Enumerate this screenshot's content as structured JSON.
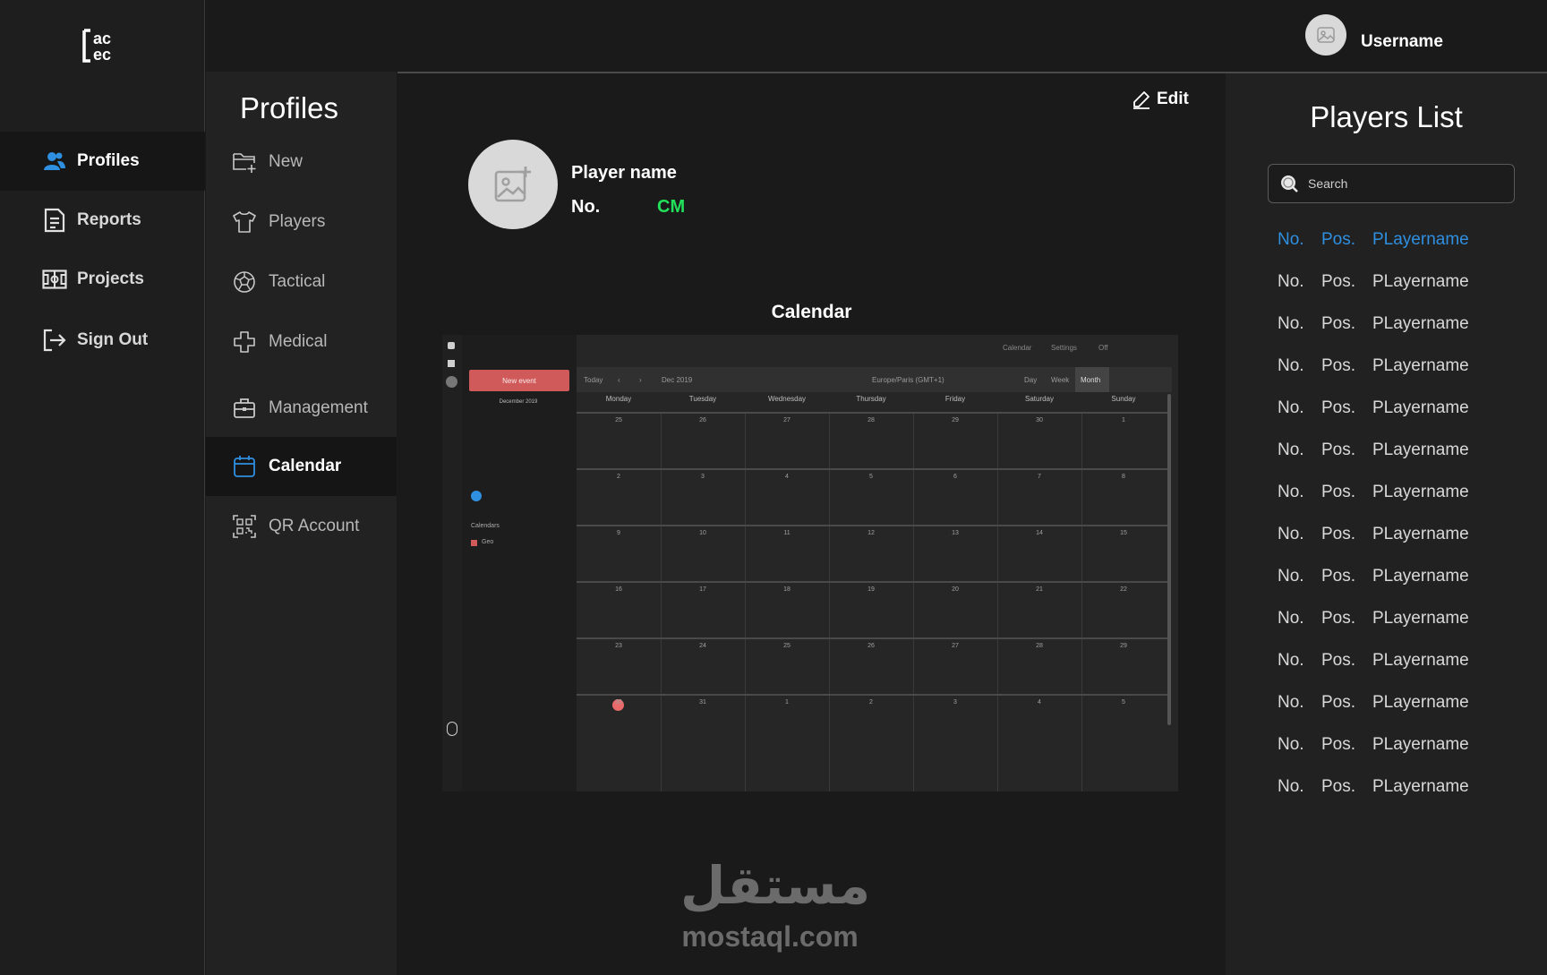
{
  "user": {
    "name": "Username"
  },
  "nav": [
    {
      "label": "Profiles",
      "icon": "user-group-icon",
      "active": true
    },
    {
      "label": "Reports",
      "icon": "document-icon",
      "active": false
    },
    {
      "label": "Projects",
      "icon": "pitch-icon",
      "active": false
    },
    {
      "label": "Sign Out",
      "icon": "sign-out-icon",
      "active": false
    }
  ],
  "submenu": {
    "title": "Profiles",
    "items": [
      {
        "label": "New",
        "icon": "new-folder-icon"
      },
      {
        "label": "Players",
        "icon": "shirt-icon"
      },
      {
        "label": "Tactical",
        "icon": "football-icon"
      },
      {
        "label": "Medical",
        "icon": "medical-cross-icon"
      },
      {
        "label": "Management",
        "icon": "briefcase-icon"
      },
      {
        "label": "Calendar",
        "icon": "calendar-icon",
        "active": true
      },
      {
        "label": "QR Account",
        "icon": "qr-code-icon"
      }
    ]
  },
  "profile": {
    "edit_label": "Edit",
    "name_label": "Player name",
    "no_label": "No.",
    "position": "CM",
    "position_color": "#22e05a"
  },
  "calendar": {
    "title": "Calendar",
    "new_event": "New event",
    "today": "Today",
    "month_label": "Dec 2019",
    "timezone": "Europe/Paris (GMT+1)",
    "views": [
      "Day",
      "Week",
      "Month"
    ],
    "top_links": [
      "Calendar",
      "Settings",
      "Off"
    ],
    "mini_title": "December 2019",
    "calendars_label": "Calendars",
    "calendar_name": "Geo",
    "days": [
      "Monday",
      "Tuesday",
      "Wednesday",
      "Thursday",
      "Friday",
      "Saturday",
      "Sunday"
    ],
    "weeks": [
      [
        "25",
        "26",
        "27",
        "28",
        "29",
        "30",
        "1"
      ],
      [
        "2",
        "3",
        "4",
        "5",
        "6",
        "7",
        "8"
      ],
      [
        "9",
        "10",
        "11",
        "12",
        "13",
        "14",
        "15"
      ],
      [
        "16",
        "17",
        "18",
        "19",
        "20",
        "21",
        "22"
      ],
      [
        "23",
        "24",
        "25",
        "26",
        "27",
        "28",
        "29"
      ],
      [
        "30",
        "31",
        "1",
        "2",
        "3",
        "4",
        "5"
      ]
    ],
    "accent": "#d05a5a"
  },
  "players": {
    "title": "Players List",
    "search_placeholder": "Search",
    "highlight_color": "#2f8fe0",
    "rows": [
      {
        "no": "No.",
        "pos": "Pos.",
        "name": "PLayername"
      },
      {
        "no": "No.",
        "pos": "Pos.",
        "name": "PLayername"
      },
      {
        "no": "No.",
        "pos": "Pos.",
        "name": "PLayername"
      },
      {
        "no": "No.",
        "pos": "Pos.",
        "name": "PLayername"
      },
      {
        "no": "No.",
        "pos": "Pos.",
        "name": "PLayername"
      },
      {
        "no": "No.",
        "pos": "Pos.",
        "name": "PLayername"
      },
      {
        "no": "No.",
        "pos": "Pos.",
        "name": "PLayername"
      },
      {
        "no": "No.",
        "pos": "Pos.",
        "name": "PLayername"
      },
      {
        "no": "No.",
        "pos": "Pos.",
        "name": "PLayername"
      },
      {
        "no": "No.",
        "pos": "Pos.",
        "name": "PLayername"
      },
      {
        "no": "No.",
        "pos": "Pos.",
        "name": "PLayername"
      },
      {
        "no": "No.",
        "pos": "Pos.",
        "name": "PLayername"
      },
      {
        "no": "No.",
        "pos": "Pos.",
        "name": "PLayername"
      },
      {
        "no": "No.",
        "pos": "Pos.",
        "name": "PLayername"
      }
    ]
  },
  "watermark": {
    "arabic": "مستقل",
    "latin": "mostaql.com"
  }
}
